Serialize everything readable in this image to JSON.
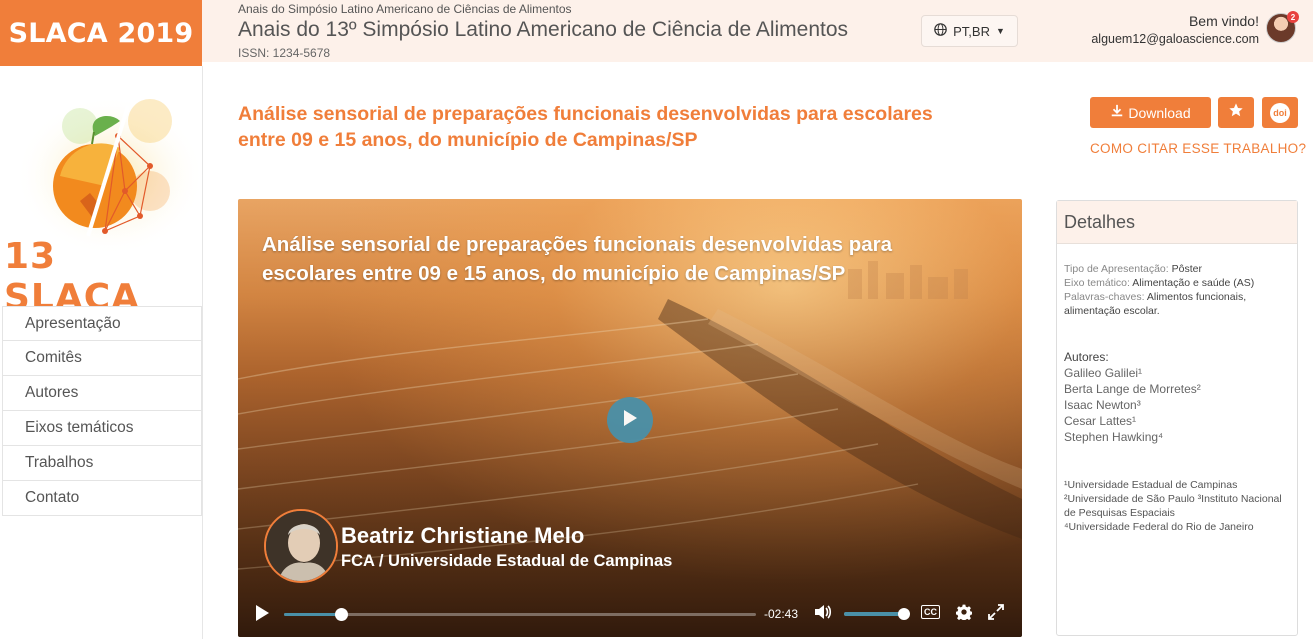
{
  "brand": {
    "label": "SLACA 2019",
    "logo_text": "13 SLACA"
  },
  "sidebar": {
    "items": [
      {
        "label": "Apresentação"
      },
      {
        "label": "Comitês"
      },
      {
        "label": "Autores"
      },
      {
        "label": "Eixos temáticos"
      },
      {
        "label": "Trabalhos"
      },
      {
        "label": "Contato"
      }
    ]
  },
  "header": {
    "subtitle": "Anais do Simpósio Latino Americano de Ciências de Alimentos",
    "title": "Anais do 13º Simpósio Latino Americano de Ciência de Alimentos",
    "issn": "ISSN: 1234-5678",
    "language": "PT,BR",
    "welcome": "Bem vindo!",
    "user_email": "alguem12@galoascience.com",
    "notification_count": "2"
  },
  "article": {
    "title": "Análise sensorial de preparações funcionais desenvolvidas para escolares entre 09 e 15 anos, do município de Campinas/SP",
    "download_label": "Download",
    "doi_label": "doi",
    "cite_label": "COMO CITAR ESSE TRABALHO?"
  },
  "video": {
    "title": "Análise sensorial de preparações funcionais desenvolvidas para escolares entre 09 e 15 anos, do município de Campinas/SP",
    "speaker_name": "Beatriz Christiane Melo",
    "speaker_affiliation": "FCA / Universidade Estadual de Campinas",
    "time_remaining": "-02:43",
    "progress_fraction": 0.12,
    "volume_fraction": 1.0,
    "cc_label": "CC"
  },
  "details": {
    "heading": "Detalhes",
    "presentation_type_label": "Tipo de Apresentação:",
    "presentation_type": "Pôster",
    "theme_label": "Eixo temático:",
    "theme": "Alimentação e saúde (AS)",
    "keywords_label": "Palavras-chaves:",
    "keywords": "Alimentos funcionais, alimentação escolar.",
    "authors_label": "Autores:",
    "authors": [
      "Galileo Galilei¹",
      "Berta Lange de Morretes²",
      "Isaac Newton³",
      "Cesar Lattes¹",
      "Stephen Hawking⁴"
    ],
    "affiliations": [
      "¹Universidade Estadual de Campinas",
      "²Universidade de São Paulo ³Instituto Nacional de Pesquisas Espaciais",
      "⁴Universidade Federal do Rio de Janeiro"
    ]
  },
  "colors": {
    "accent": "#f07e3a",
    "header_bg": "#fdf1ea",
    "player_accent": "#4a90a8"
  }
}
